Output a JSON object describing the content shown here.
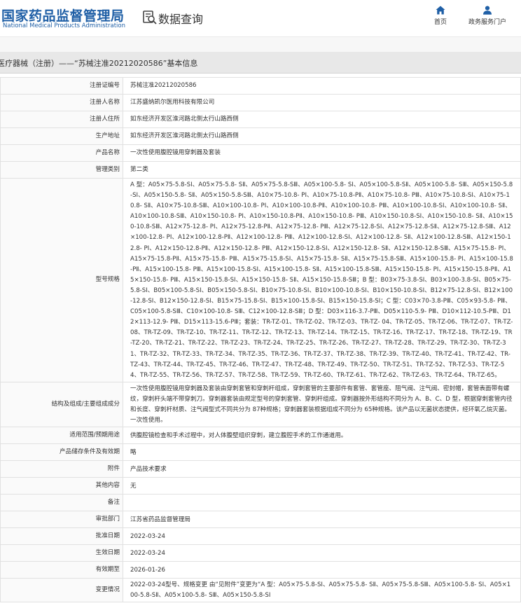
{
  "header": {
    "logo_cn": "国家药品监督管理局",
    "logo_en": "National Medical Products Administration",
    "title": "数据查询",
    "nav": [
      {
        "label": "首页",
        "icon": "home-icon"
      },
      {
        "label": "政务服务门户",
        "icon": "user-icon"
      }
    ]
  },
  "breadcrumb": "医疗器械（注册）——“苏械注准20212020586”基本信息",
  "colors": {
    "brand": "#1f5fa6",
    "breadcrumb_bg": "#e8e8e8"
  },
  "rows": [
    {
      "label": "注册证编号",
      "value": "苏械注准20212020586"
    },
    {
      "label": "注册人名称",
      "value": "江苏盛纳凯尔医用科技有限公司"
    },
    {
      "label": "注册人住所",
      "value": "如东经济开发区淮河路北侧太行山路西侧"
    },
    {
      "label": "生产地址",
      "value": "如东经济开发区淮河路北侧太行山路西侧"
    },
    {
      "label": "产品名称",
      "value": "一次性使用腹腔镜用穿刺器及套装"
    },
    {
      "label": "管理类别",
      "value": "第二类"
    },
    {
      "label": "型号规格",
      "value": "A 型：A05×75-5.8-SⅠ、A05×75-5.8- SⅡ、A05×75-5.8-SⅢ、A05×100-5.8- SⅠ、A05×100-5.8-SⅡ、A05×100-5.8- SⅢ、A05×150-5.8-SⅠ、A05×150-5.8- SⅡ、A05×150-5.8-SⅢ、A10×75-10.8- PⅠ、A10×75-10.8-PⅡ、A10×75-10.8- PⅢ、A10×75-10.8-SⅠ、A10×75-10.8- SⅡ、A10×75-10.8-SⅢ、A10×100-10.8- PⅠ、A10×100-10.8-PⅡ、A10×100-10.8- PⅢ、A10×100-10.8-SⅠ、A10×100-10.8- SⅡ、A10×100-10.8-SⅢ、A10×150-10.8- PⅠ、A10×150-10.8-PⅡ、A10×150-10.8- PⅢ、A10×150-10.8-SⅠ、A10×150-10.8- SⅡ、A10×150-10.8-SⅢ、A12×75-12.8- PⅠ、A12×75-12.8-PⅡ、A12×75-12.8- PⅢ、A12×75-12.8-SⅠ、A12×75-12.8-SⅡ、A12×75-12.8-SⅢ、A12×100-12.8- PⅠ、A12×100-12.8-PⅡ、A12×100-12.8- PⅢ、A12×100-12.8-SⅠ、A12×100-12.8- SⅡ、A12×100-12.8-SⅢ、A12×150-12.8- PⅠ、A12×150-12.8-PⅡ、A12×150-12.8- PⅢ、A12×150-12.8-SⅠ、A12×150-12.8- SⅡ、A12×150-12.8-SⅢ、A15×75-15.8- PⅠ、A15×75-15.8-PⅡ、A15×75-15.8- PⅢ、A15×75-15.8-SⅠ、A15×75-15.8- SⅡ、A15×75-15.8-SⅢ、A15×100-15.8- PⅠ、A15×100-15.8-PⅡ、A15×100-15.8- PⅢ、A15×100-15.8-SⅠ、A15×100-15.8- SⅡ、A15×100-15.8-SⅢ、A15×150-15.8- PⅠ、A15×150-15.8-PⅡ、A15×150-15.8- PⅢ、A15×150-15.8-SⅠ、A15×150-15.8- SⅡ、A15×150-15.8-SⅢ；B 型：B03×75-3.8-SⅠ、B03×100-3.8-SⅠ、B05×75-5.8-SⅠ、B05×100-5.8-SⅠ、B05×150-5.8-SⅠ、B10×75-10.8-SⅠ、B10×100-10.8-SⅠ、B10×150-10.8-SⅠ、B12×75-12.8-SⅠ、B12×100-12.8-SⅠ、B12×150-12.8-SⅠ、B15×75-15.8-SⅠ、B15×100-15.8-SⅠ、B15×150-15.8-SⅠ；C 型：C03×70-3.8-PⅢ、C05×93-5.8- PⅢ、C05×100-5.8-SⅢ、C10×100-10.8- SⅢ、C12×100-12.8-SⅢ；D 型：D03×116-3.7-PⅢ、D05×110-5.9- PⅢ、D10×112-10.5-PⅢ、D12×113-12.9- PⅢ、D15×113-15.6-PⅢ；套装：TR-TZ-01、TR-TZ-02、TR-TZ-03、TR-TZ- 04、TR-TZ-05、TR-TZ-06、TR-TZ-07、TR-TZ- 08、TR-TZ-09、TR-TZ-10、TR-TZ-11、TR-TZ-12、TR-TZ-13、TR-TZ-14、TR-TZ-15、TR-TZ-16、TR-TZ-17、TR-TZ-18、TR-TZ-19、TR-TZ-20、TR-TZ-21、TR-TZ-22、TR-TZ-23、TR-TZ-24、TR-TZ-25、TR-TZ-26、TR-TZ-27、TR-TZ-28、TR-TZ-29、TR-TZ-30、TR-TZ-31、TR-TZ-32、TR-TZ-33、TR-TZ-34、TR-TZ-35、TR-TZ-36、TR-TZ-37、TR-TZ-38、TR-TZ-39、TR-TZ-40、TR-TZ-41、TR-TZ-42、TR-TZ-43、TR-TZ-44、TR-TZ-45、TR-TZ-46、TR-TZ-47、TR-TZ-48、TR-TZ-49、TR-TZ-50、TR-TZ-51、TR-TZ-52、TR-TZ-53、TR-TZ-54、TR-TZ-55、TR-TZ-56、TR-TZ-57、TR-TZ-58、TR-TZ-59、TR-TZ-60、TR-TZ-61、TR-TZ-62、TR-TZ-63、TR-TZ-64、TR-TZ-65。"
    },
    {
      "label": "结构及组成/主要组成成分",
      "value": "一次性使用腹腔镜用穿刺器及套装由穿刺套管和穿刺杆组成，穿刺套管的主要部件有套管、套管座、阻气阀、注气阀、密封帽，套管表面带有螺纹，穿刺杆头端不带穿刺刀。穿刺器套装由规定型号的穿刺套管、穿刺杆组成。穿刺器按外形结构不同分为 A、B、C、D 型，根据穿刺套管内径和长度、穿刺杆材质、注气阀型式不同共分为 87种规格；穿刺器套装根据组成不同分为 65种规格。该产品以无菌状态提供，经环氧乙烷灭菌。一次性使用。"
    },
    {
      "label": "适用范围/预期用途",
      "value": "供腹腔镜检查和手术过程中，对人体腹壁组织穿刺，建立腹腔手术的工作通道用。"
    },
    {
      "label": "产品储存条件及有效期",
      "value": "略"
    },
    {
      "label": "附件",
      "value": "产品技术要求"
    },
    {
      "label": "其他内容",
      "value": "无"
    },
    {
      "label": "备注",
      "value": ""
    },
    {
      "label": "审批部门",
      "value": "江苏省药品监督管理局"
    },
    {
      "label": "批准日期",
      "value": "2022-03-24"
    },
    {
      "label": "生效日期",
      "value": "2022-03-24"
    },
    {
      "label": "有效期至",
      "value": "2026-01-26"
    },
    {
      "label": "变更情况",
      "value": "2022-03-24型号、规格变更 由“见附件”变更为“A 型：A05×75-5.8-SⅠ、A05×75-5.8- SⅡ、A05×75-5.8-SⅢ、A05×100-5.8- SⅠ、A05×100-5.8-SⅡ、A05×100-5.8- SⅢ、A05×150-5.8-SⅠ"
    }
  ]
}
